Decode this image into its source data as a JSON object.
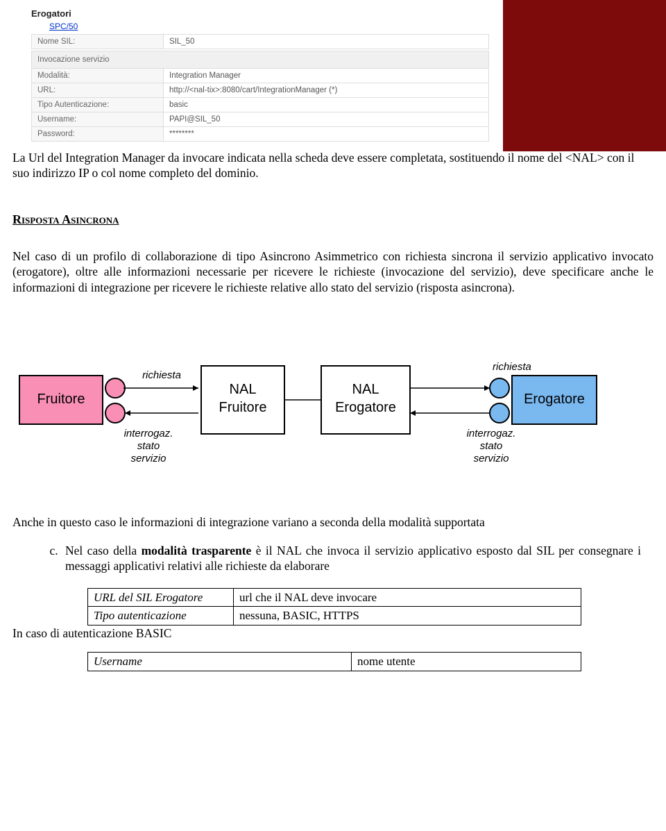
{
  "screenshot": {
    "heading": "Erogatori",
    "spc_link": "SPC/50",
    "rows": [
      {
        "label": "Nome SIL:",
        "value": "SIL_50"
      }
    ],
    "section": "Invocazione servizio",
    "rows2": [
      {
        "label": "Modalità:",
        "value": "Integration Manager"
      },
      {
        "label": "URL:",
        "value": "http://<nal-tix>:8080/cart/IntegrationManager (*)"
      },
      {
        "label": "Tipo Autenticazione:",
        "value": "basic"
      },
      {
        "label": "Username:",
        "value": "PAPI@SIL_50"
      },
      {
        "label": "Password:",
        "value": "********"
      }
    ]
  },
  "para1": "La Url del Integration Manager da invocare indicata nella scheda deve essere completata, sostituendo il nome del <NAL> con il suo indirizzo IP o col nome completo del dominio.",
  "section_title": "Risposta Asincrona",
  "para2": "Nel caso di un profilo di collaborazione di tipo Asincrono Asimmetrico con richiesta sincrona il servizio applicativo invocato (erogatore), oltre alle informazioni necessarie per ricevere le richieste (invocazione del servizio), deve specificare anche le informazioni di integrazione per ricevere le richieste relative allo stato del servizio (risposta asincrona).",
  "diagram": {
    "boxes": {
      "fruitore": "Fruitore",
      "nal_fruitore_l1": "NAL",
      "nal_fruitore_l2": "Fruitore",
      "nal_erogatore_l1": "NAL",
      "nal_erogatore_l2": "Erogatore",
      "erogatore": "Erogatore"
    },
    "labels": {
      "richiesta_left": "richiesta",
      "interrogaz_left_l1": "interrogaz.",
      "interrogaz_left_l2": "stato",
      "interrogaz_left_l3": "servizio",
      "richiesta_right": "richiesta",
      "interrogaz_right_l1": "interrogaz.",
      "interrogaz_right_l2": "stato",
      "interrogaz_right_l3": "servizio"
    }
  },
  "para3": "Anche in questo caso le informazioni di integrazione variano a seconda della modalità supportata",
  "list_c_prefix": "Nel caso della ",
  "list_c_bold": "modalità trasparente",
  "list_c_suffix": " è il NAL che invoca il servizio applicativo esposto dal SIL per consegnare i messaggi applicativi relativi alle richieste da elaborare",
  "inner_table": {
    "row1": {
      "k": "URL del SIL Erogatore",
      "v": "url che il NAL deve invocare"
    },
    "row2": {
      "k": "Tipo autenticazione",
      "v": "nessuna, BASIC, HTTPS"
    }
  },
  "para4": "In caso di autenticazione BASIC",
  "user_row": {
    "k": "Username",
    "v": "nome utente"
  }
}
